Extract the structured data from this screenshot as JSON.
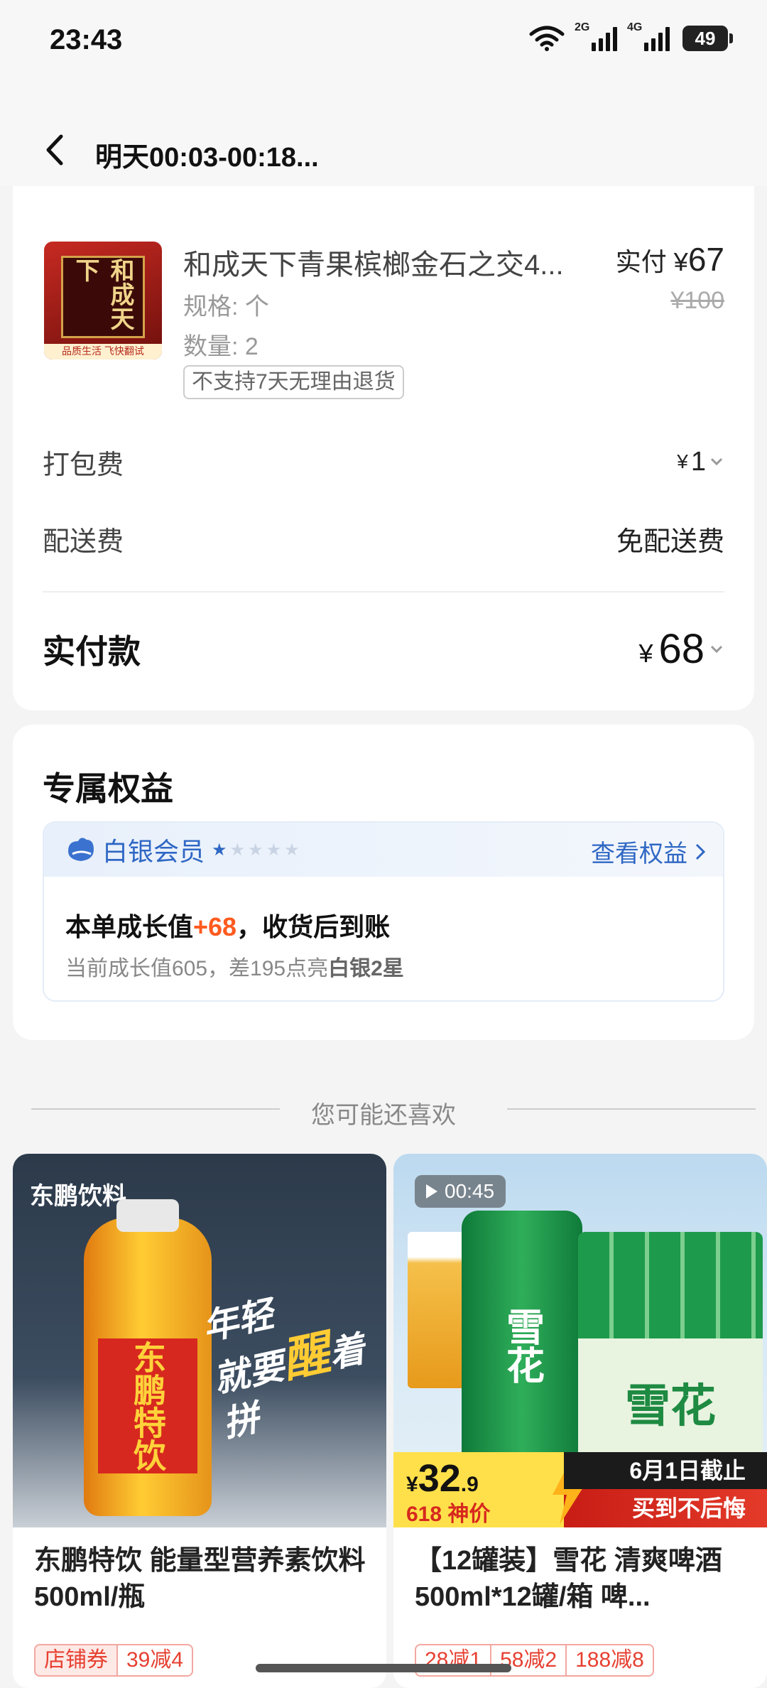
{
  "status_bar": {
    "time": "23:43",
    "sim1": "2G",
    "sim2": "4G",
    "battery": "49"
  },
  "nav": {
    "title": "明天00:03-00:18..."
  },
  "order": {
    "peek_text": "",
    "product": {
      "name": "和成天下青果槟榔金石之交4...",
      "price_label": "实付",
      "price_symbol": "¥",
      "price": "67",
      "original_price": "¥100",
      "spec": "规格: 个",
      "quantity": "数量: 2",
      "return_tag": "不支持7天无理由退货",
      "image_text": "和成天下",
      "image_tagline": "品质生活 飞快翻试"
    },
    "packing_fee": {
      "label": "打包费",
      "symbol": "¥",
      "value": "1"
    },
    "delivery_fee": {
      "label": "配送费",
      "value": "免配送费"
    },
    "total": {
      "label": "实付款",
      "symbol": "¥",
      "value": "68"
    }
  },
  "benefits": {
    "title": "专属权益",
    "member": {
      "level": "白银会员",
      "stars_on": "★",
      "stars_off": "★★★★",
      "link": "查看权益",
      "growth_prefix": "本单成长值",
      "growth_value": "+68",
      "growth_suffix": "，收货后到账",
      "sub_prefix": "当前成长值605，差195点亮",
      "sub_bold": "白银2星"
    }
  },
  "recommend": {
    "heading": "您可能还喜欢",
    "items": [
      {
        "brand": "东鹏饮料",
        "bottle_label": "东鹏特饮",
        "slogan_1": "年轻",
        "slogan_2": "就要",
        "slogan_big": "醒",
        "slogan_3": "着拼",
        "title": "东鹏特饮 能量型营养素饮料 500ml/瓶",
        "coupon_shop": "店铺券",
        "coupons": [
          "39减4"
        ]
      },
      {
        "video_time": "00:45",
        "can_text": "雪花",
        "box_text": "雪花",
        "price_symbol": "¥",
        "price_main": "32",
        "price_dec": ".9",
        "price_tag": "618 神价",
        "promo_top": "6月1日截止",
        "promo_bottom": "买到不后悔",
        "title": "【12罐装】雪花 清爽啤酒 500ml*12罐/箱 啤...",
        "coupons": [
          "28减1",
          "58减2",
          "188减8"
        ]
      }
    ]
  },
  "colors": {
    "accent_blue": "#2f67c4",
    "accent_orange": "#ff5a1f",
    "coupon_red": "#e64031"
  }
}
